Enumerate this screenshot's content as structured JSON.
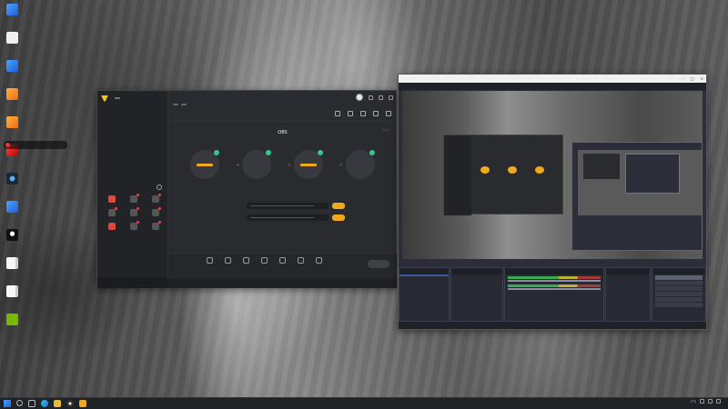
{
  "app": {
    "title": "",
    "version_badge": "",
    "left_tabs": [
      "",
      "",
      ""
    ],
    "left_empty_text": "",
    "tools_title": "",
    "tools": [
      {
        "label": "",
        "icon": "gift-icon",
        "hot": true
      },
      {
        "label": "",
        "icon": "chat-icon",
        "hot": false
      },
      {
        "label": "",
        "icon": "task-icon",
        "hot": false
      },
      {
        "label": "",
        "icon": "video-icon",
        "hot": false
      },
      {
        "label": "",
        "icon": "user-icon",
        "hot": false
      },
      {
        "label": "",
        "icon": "calendar-icon",
        "hot": false
      },
      {
        "label": "",
        "icon": "camera-icon",
        "hot": true
      },
      {
        "label": "",
        "icon": "grid-icon",
        "hot": false
      },
      {
        "label": "",
        "icon": "upload-icon",
        "hot": false
      }
    ],
    "left_notice": "",
    "stream_title": "",
    "stream_edit_label": "",
    "stream_sub_items": [
      "",
      "",
      ""
    ],
    "mode_title": "OBS",
    "mode_switch_label": "",
    "steps": [
      {
        "circle_lines": [
          "",
          ""
        ],
        "has_bar": true,
        "caption": ""
      },
      {
        "circle_lines": [
          "",
          ""
        ],
        "has_bar": false,
        "caption": ""
      },
      {
        "circle_lines": [
          "",
          ""
        ],
        "has_bar": true,
        "caption": ""
      },
      {
        "circle_lines": [
          "",
          ""
        ],
        "has_bar": false,
        "caption": ""
      }
    ],
    "url_rows": [
      {
        "label": "",
        "button": ""
      },
      {
        "label": "",
        "button": ""
      }
    ],
    "url_hint": "",
    "bottom_tools": [
      "",
      "",
      "",
      "",
      "",
      "",
      ""
    ],
    "start_button": ""
  },
  "desktop": {
    "icons": [
      {
        "icon": "recycle-bin-icon",
        "label": "",
        "color": "g-blue"
      },
      {
        "icon": "file-icon",
        "label": "",
        "color": "g-white"
      },
      {
        "icon": "edge-icon",
        "label": "",
        "color": "g-blue"
      },
      {
        "icon": "app-icon",
        "label": "",
        "color": "g-orange"
      },
      {
        "icon": "app-icon",
        "label": "",
        "color": "g-orange"
      },
      {
        "icon": "live-icon",
        "label": "",
        "color": "g-red"
      },
      {
        "icon": "steam-icon",
        "label": "",
        "color": "g-steam"
      },
      {
        "icon": "app-icon",
        "label": "",
        "color": "g-blue"
      },
      {
        "icon": "qq-icon",
        "label": "",
        "color": "g-qq"
      },
      {
        "icon": "file-icon",
        "label": "",
        "color": "g-file"
      },
      {
        "icon": "file-icon",
        "label": "",
        "color": "g-file"
      },
      {
        "icon": "nvidia-icon",
        "label": "",
        "color": "g-nvidia"
      }
    ],
    "banner": ""
  },
  "obs": {
    "titlebar": "",
    "menu": [
      "",
      "",
      "",
      "",
      "",
      "",
      "",
      ""
    ],
    "scenes_title": "",
    "scenes": [
      ""
    ],
    "sources_title": "",
    "sources": [
      ""
    ],
    "mixer_title": "",
    "mixer_channels": [
      {
        "name": "",
        "db": ""
      },
      {
        "name": "",
        "db": ""
      }
    ],
    "transitions_title": "",
    "controls_title": "",
    "controls": [
      "",
      "",
      "",
      "",
      "",
      ""
    ],
    "status": [
      "",
      "",
      ""
    ]
  },
  "taskbar": {
    "weather": "7°C",
    "time": "",
    "date": ""
  },
  "colors": {
    "accent": "#f2a81d",
    "hot": "#e0483e",
    "ok": "#3cc38c"
  }
}
